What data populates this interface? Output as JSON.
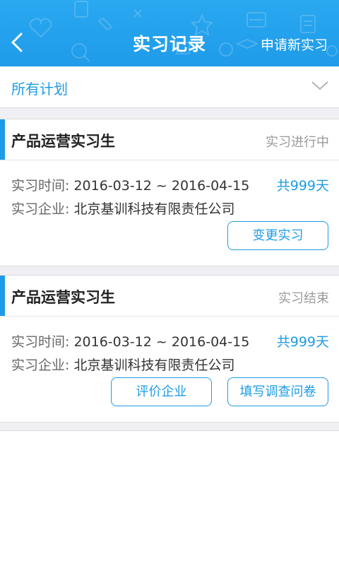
{
  "header": {
    "title": "实习记录",
    "action_label": "申请新实习",
    "accent_color": "#1f9be9"
  },
  "filter": {
    "selected": "所有计划"
  },
  "records": [
    {
      "title": "产品运营实习生",
      "status": "实习进行中",
      "time_label": "实习时间:",
      "time_range": "2016-03-12 ~ 2016-04-15",
      "duration": "共999天",
      "company_label": "实习企业:",
      "company": "北京基训科技有限责任公司",
      "buttons": [
        "变更实习"
      ]
    },
    {
      "title": "产品运营实习生",
      "status": "实习结束",
      "time_label": "实习时间:",
      "time_range": "2016-03-12 ~ 2016-04-15",
      "duration": "共999天",
      "company_label": "实习企业:",
      "company": "北京基训科技有限责任公司",
      "buttons": [
        "评价企业",
        "填写调查问卷"
      ]
    }
  ],
  "colors": {
    "accent": "#1e9be6",
    "status_gray": "#9a9a9a",
    "background_gap": "#efeff4"
  },
  "icons": {
    "back": "chevron-left-icon",
    "filter": "chevron-down-icon"
  }
}
